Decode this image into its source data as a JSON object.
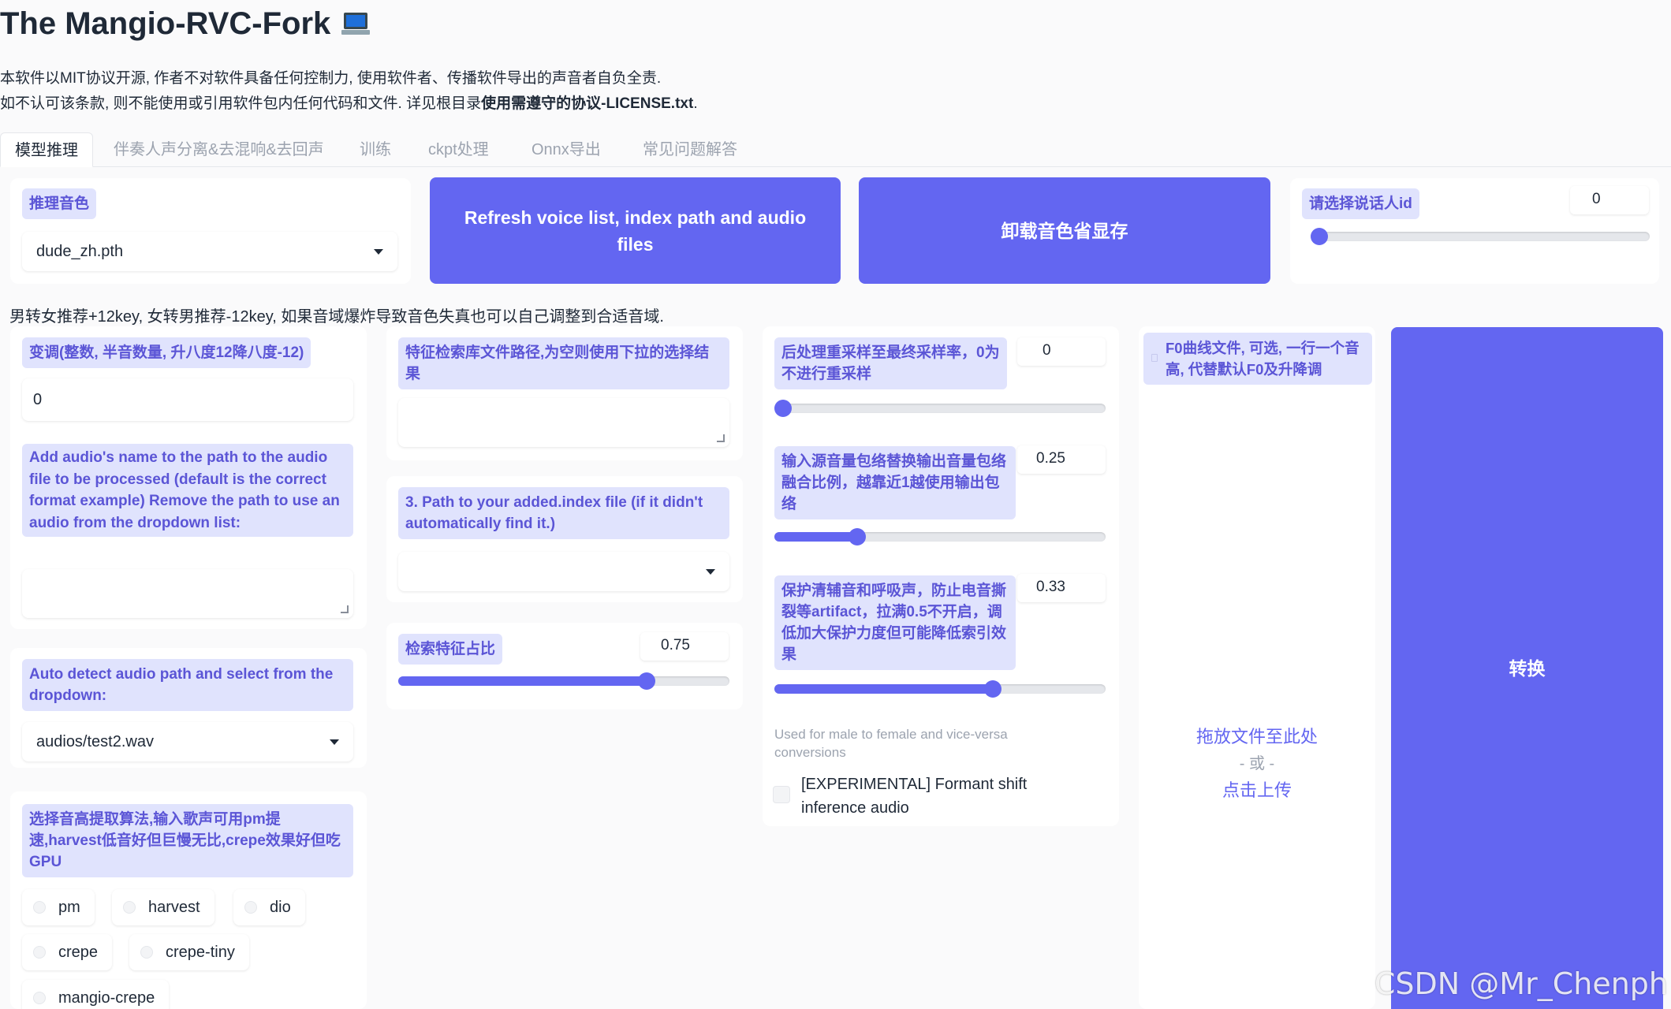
{
  "header": {
    "title": "The Mangio-RVC-Fork",
    "title_icon": "laptop-icon",
    "line1": "本软件以MIT协议开源, 作者不对软件具备任何控制力, 使用软件者、传播软件导出的声音者自负全责.",
    "line2_prefix": "如不认可该条款, 则不能使用或引用软件包内任何代码和文件. 详见根目录",
    "line2_bold": "使用需遵守的协议-LICENSE.txt",
    "line2_suffix": "."
  },
  "tabs": [
    {
      "label": "模型推理",
      "active": true
    },
    {
      "label": "伴奏人声分离&去混响&去回声"
    },
    {
      "label": "训练"
    },
    {
      "label": "ckpt处理"
    },
    {
      "label": "Onnx导出"
    },
    {
      "label": "常见问题解答"
    }
  ],
  "top": {
    "voice_label": "推理音色",
    "voice_value": "dude_zh.pth",
    "refresh_button": "Refresh voice list, index path and audio files",
    "unload_button": "卸载音色省显存",
    "speaker_label": "请选择说话人id",
    "speaker_value": "0",
    "speaker_fraction": 0.0
  },
  "pitch_note": "男转女推荐+12key, 女转男推荐-12key, 如果音域爆炸导致音色失真也可以自己调整到合适音域.",
  "col1": {
    "transpose_label": "变调(整数, 半音数量, 升八度12降八度-12)",
    "transpose_value": "0",
    "audio_path_label": "Add audio's name to the path to the audio file to be processed (default is the correct format example) Remove the path to use an audio from the dropdown list:",
    "audio_path_value": "",
    "auto_detect_label": "Auto detect audio path and select from the dropdown:",
    "auto_detect_value": "audios/test2.wav",
    "f0_method_label": "选择音高提取算法,输入歌声可用pm提速,harvest低音好但巨慢无比,crepe效果好但吃GPU",
    "f0_methods": [
      "pm",
      "harvest",
      "dio",
      "crepe",
      "crepe-tiny",
      "mangio-crepe"
    ]
  },
  "col2": {
    "index_path_label": "特征检索库文件路径,为空则使用下拉的选择结果",
    "index_path_value": "",
    "added_index_label": "3. Path to your added.index file (if it didn't automatically find it.)",
    "added_index_value": "",
    "index_rate_label": "检索特征占比",
    "index_rate_value": "0.75",
    "index_rate_fraction": 0.75
  },
  "col3": {
    "resample_label": "后处理重采样至最终采样率，0为不进行重采样",
    "resample_value": "0",
    "resample_fraction": 0.0,
    "rms_label": "输入源音量包络替换输出音量包络融合比例，越靠近1越使用输出包络",
    "rms_value": "0.25",
    "rms_fraction": 0.25,
    "protect_label": "保护清辅音和呼吸声，防止电音撕裂等artifact，拉满0.5不开启，调低加大保护力度但可能降低索引效果",
    "protect_value": "0.33",
    "protect_fraction": 0.66,
    "formant_hint": "Used for male to female and vice-versa conversions",
    "formant_label": "[EXPERIMENTAL] Formant shift inference audio"
  },
  "col4": {
    "f0_file_label": "F0曲线文件, 可选, 一行一个音高, 代替默认F0及升降调",
    "upload_drop": "拖放文件至此处",
    "upload_or": "- 或 -",
    "upload_click": "点击上传"
  },
  "convert_button": "转换",
  "watermark": "CSDN @Mr_Chenph",
  "colors": {
    "accent": "#6366f1",
    "label_bg": "#e0e3fd",
    "label_text": "#5b55d6"
  }
}
